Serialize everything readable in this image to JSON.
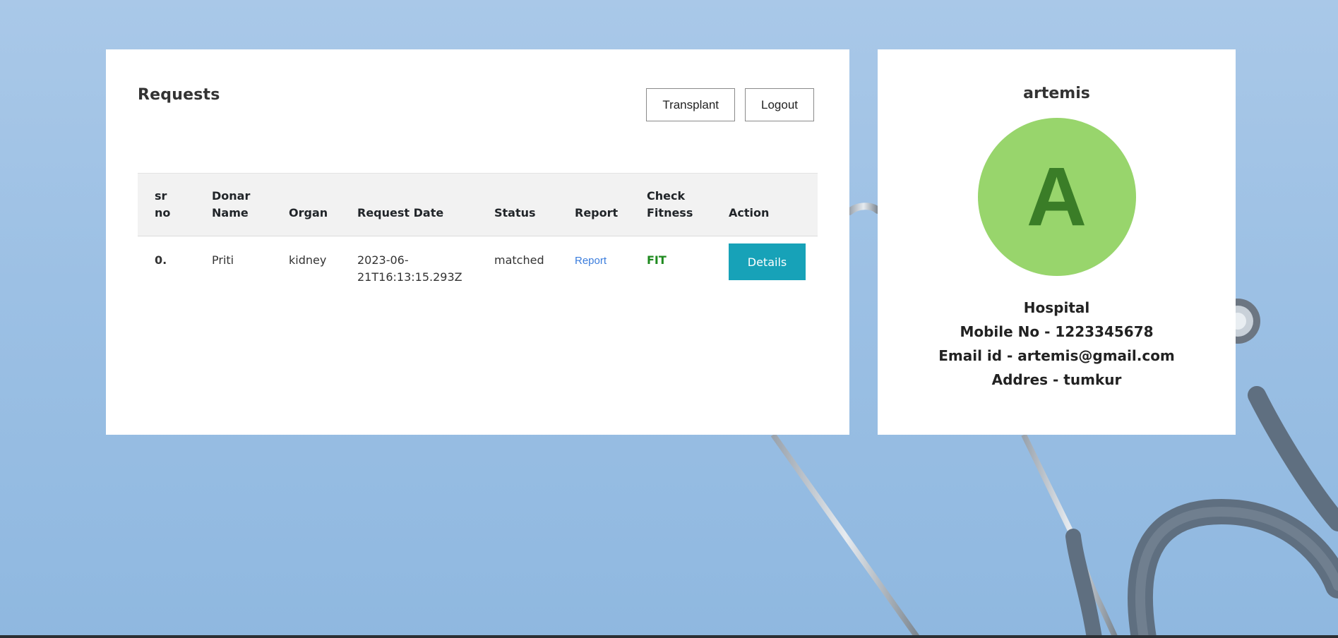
{
  "requests_panel": {
    "title": "Requests",
    "buttons": {
      "transplant": "Transplant",
      "logout": "Logout"
    },
    "table": {
      "headers": {
        "sr_line1": "sr",
        "sr_line2": "no",
        "donor_line1": "Donar",
        "donor_line2": "Name",
        "organ": "Organ",
        "request_date": "Request Date",
        "status": "Status",
        "report": "Report",
        "fitness_line1": "Check",
        "fitness_line2": "Fitness",
        "action": "Action"
      },
      "rows": [
        {
          "sr_no": "0.",
          "donor_name": "Priti",
          "organ": "kidney",
          "request_date_line1": "2023-06-",
          "request_date_line2": "21T16:13:15.293Z",
          "status": "matched",
          "report_link": "Report",
          "fitness": "FIT",
          "action": "Details"
        }
      ]
    }
  },
  "profile_panel": {
    "name": "artemis",
    "avatar_letter": "A",
    "type": "Hospital",
    "mobile": "Mobile No - 1223345678",
    "email": "Email id - artemis@gmail.com",
    "address": "Addres - tumkur"
  },
  "colors": {
    "background": "#9cc0e4",
    "avatar_bg": "#98d56c",
    "avatar_letter": "#3a7d27",
    "details_button": "#17a2b8",
    "fit_text": "#1f8a1f",
    "report_link": "#3b7ddd"
  }
}
